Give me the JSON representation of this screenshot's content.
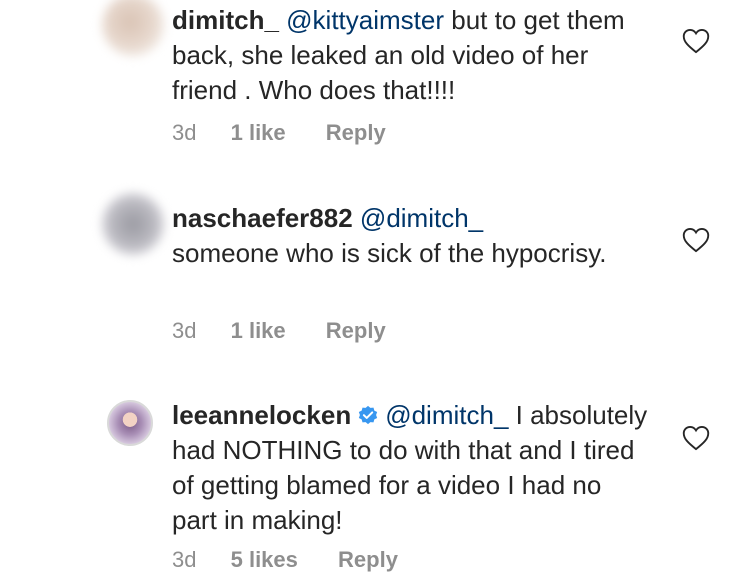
{
  "comments": [
    {
      "username": "dimitch_",
      "mention": "@kittyaimster",
      "text": " but to get them back, she leaked an old video of her friend . Who does that!!!!",
      "age": "3d",
      "likes": "1 like",
      "reply_label": "Reply"
    },
    {
      "username": "naschaefer882",
      "mention": "@dimitch_",
      "text": " someone who is sick of the hypocrisy.",
      "age": "3d",
      "likes": "1 like",
      "reply_label": "Reply"
    },
    {
      "username": "leeannelocken",
      "verified": true,
      "mention": "@dimitch_",
      "text": " I absolutely had NOTHING to do with that and I tired of getting blamed for a video I had no part in making!",
      "age": "3d",
      "likes": "5 likes",
      "reply_label": "Reply"
    }
  ],
  "colors": {
    "text": "#262626",
    "mention": "#003569",
    "meta": "#8e8e8e",
    "verified": "#3897f0"
  },
  "icons": [
    "heart-outline-icon",
    "verified-badge-icon"
  ]
}
